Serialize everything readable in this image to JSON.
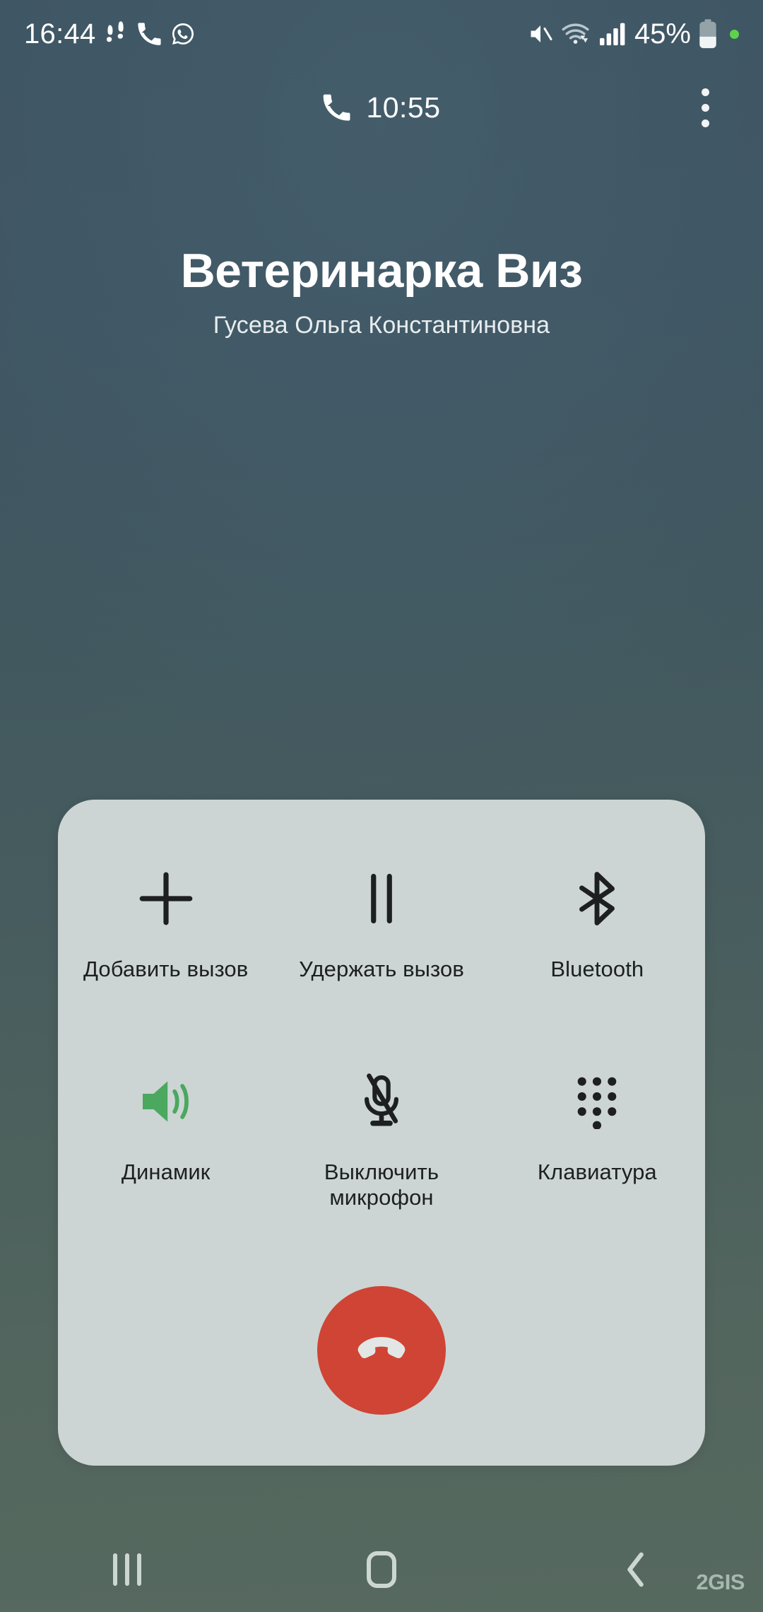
{
  "status_bar": {
    "clock": "16:44",
    "battery_percent": "45%",
    "icons": [
      "pedometer-icon",
      "phone-icon",
      "whatsapp-icon",
      "mute-icon",
      "wifi-icon",
      "signal-icon",
      "battery-icon",
      "green-dot-indicator"
    ]
  },
  "call_header": {
    "duration": "10:55",
    "phone_icon": "phone-handset-icon",
    "overflow_icon": "more-vertical-icon"
  },
  "contact": {
    "name": "Ветеринарка Виз",
    "subtitle": "Гусева Ольга Константиновна"
  },
  "controls": {
    "buttons": [
      {
        "label": "Добавить вызов",
        "icon": "plus-icon",
        "active": false
      },
      {
        "label": "Удержать вызов",
        "icon": "pause-icon",
        "active": false
      },
      {
        "label": "Bluetooth",
        "icon": "bluetooth-icon",
        "active": false
      },
      {
        "label": "Динамик",
        "icon": "speaker-icon",
        "active": true
      },
      {
        "label": "Выключить\nмикрофон",
        "icon": "microphone-off-icon",
        "active": false
      },
      {
        "label": "Клавиатура",
        "icon": "dialpad-icon",
        "active": false
      }
    ],
    "end_call": {
      "icon": "end-call-icon",
      "color": "#cf4434"
    },
    "panel_color": "#ccd5d4",
    "active_color": "#4aa85f",
    "icon_color": "#1d1f20"
  },
  "nav_bar": {
    "recents": "recents-icon",
    "home": "home-icon",
    "back": "back-icon"
  },
  "watermark": {
    "text": "2GIS"
  }
}
